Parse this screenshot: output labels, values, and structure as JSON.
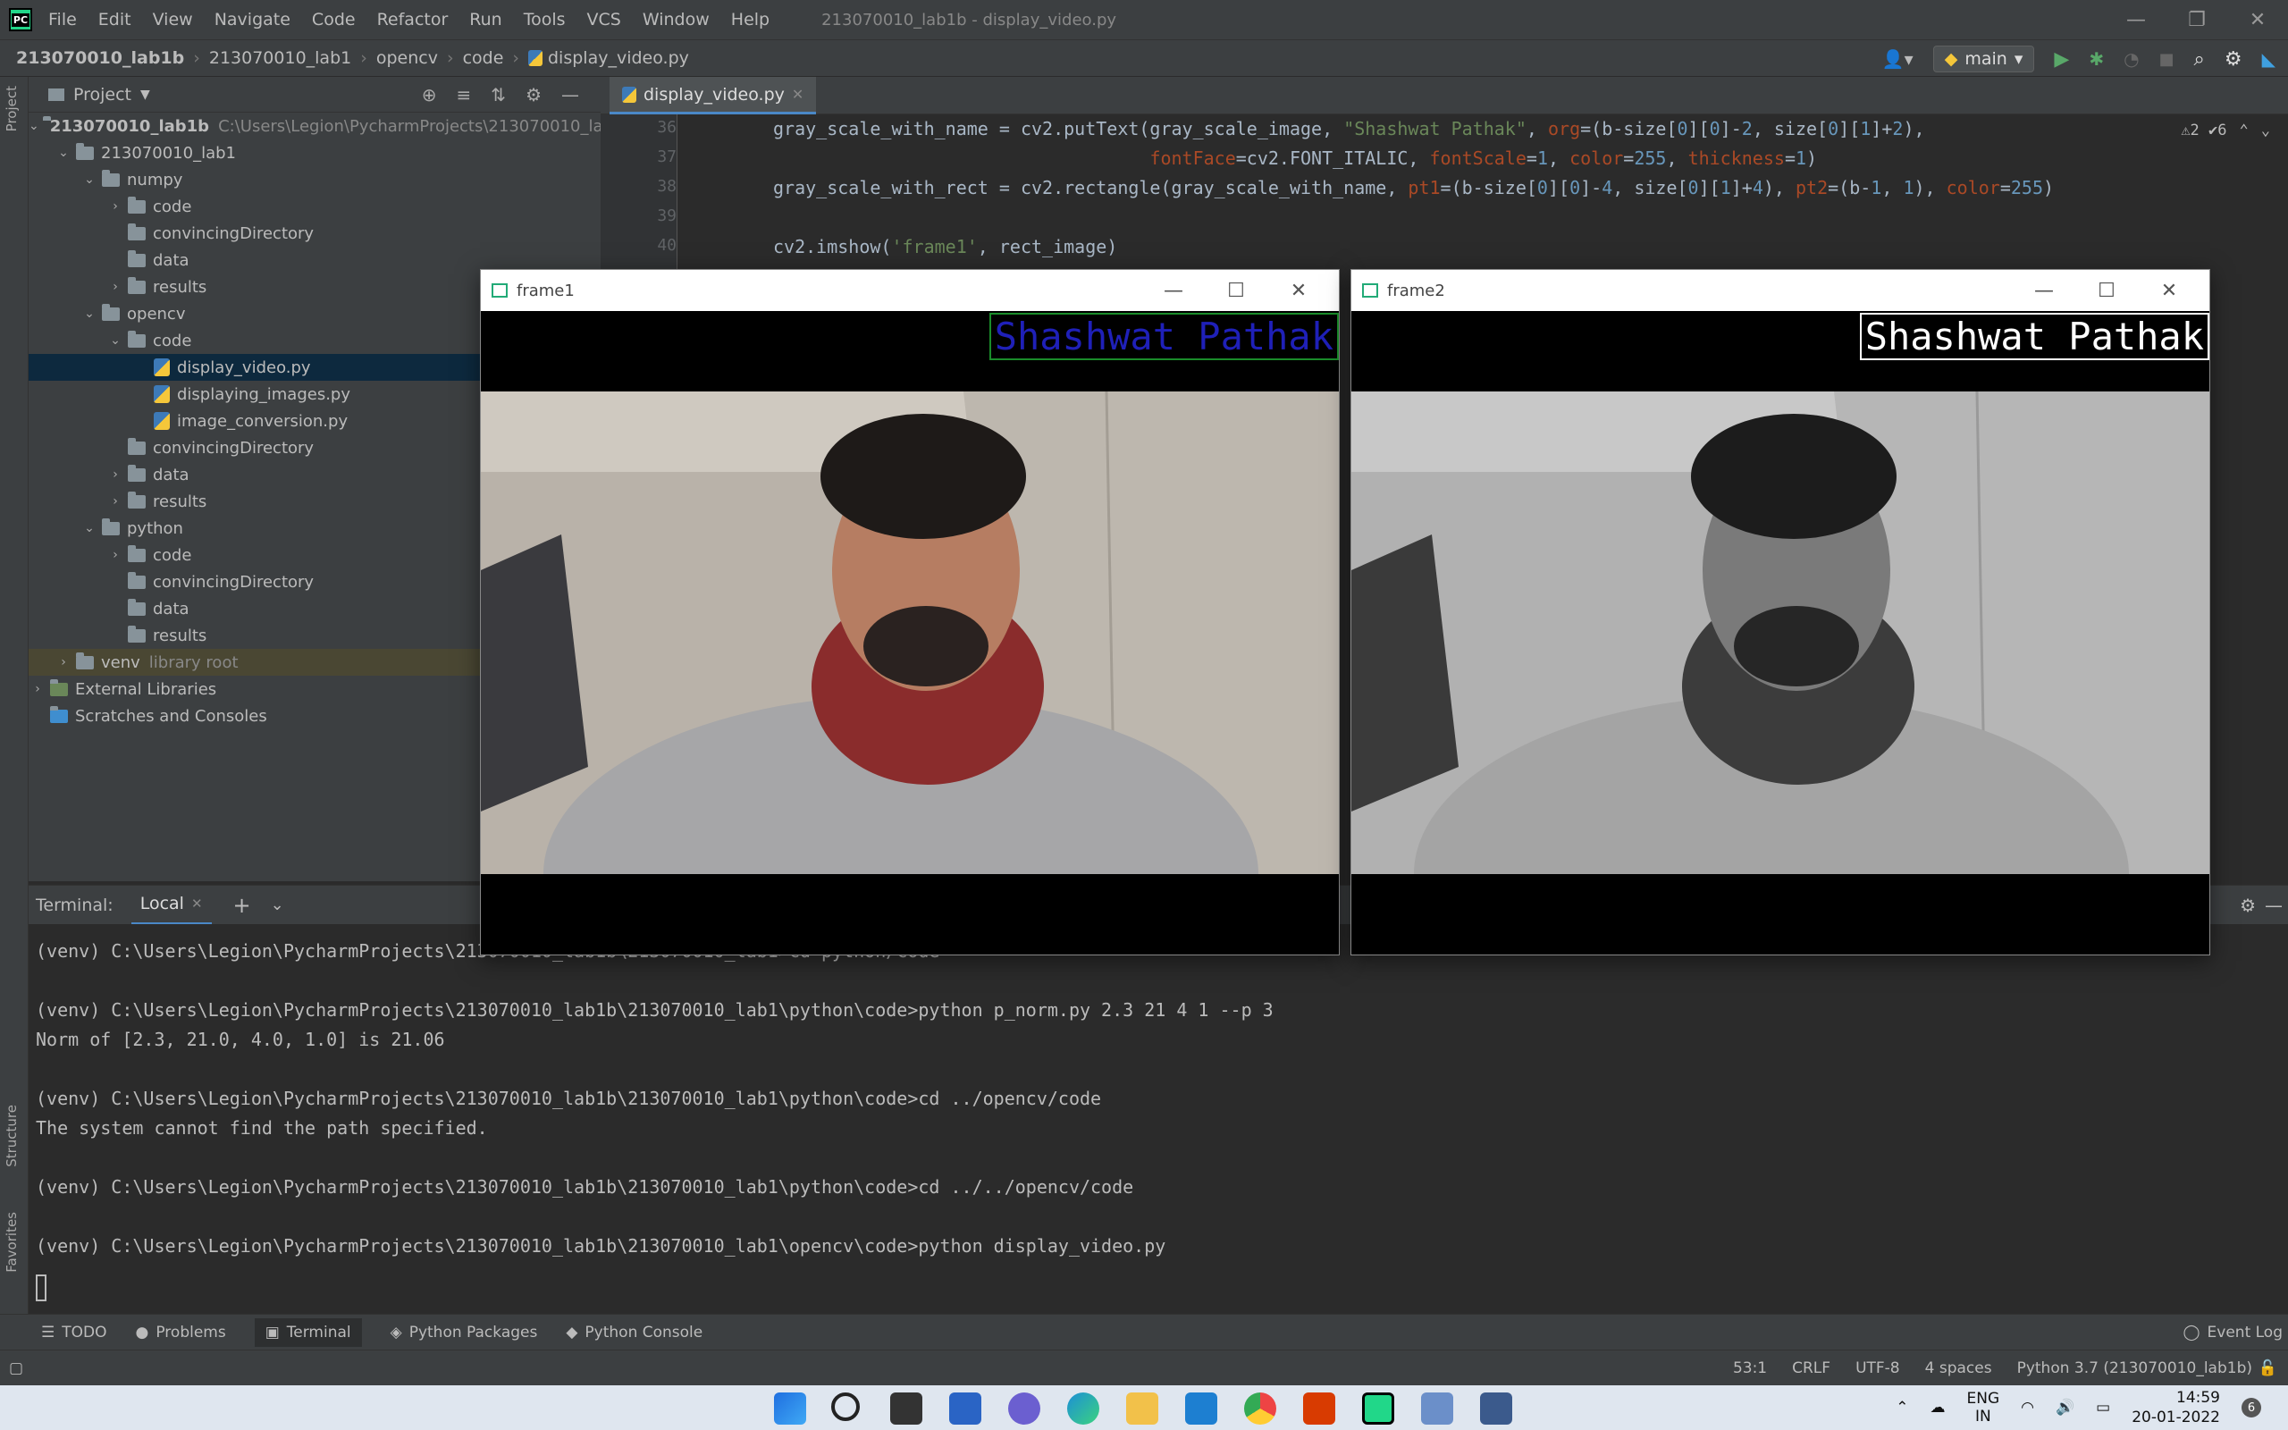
{
  "menubar": {
    "logo_text": "PC",
    "items": [
      "File",
      "Edit",
      "View",
      "Navigate",
      "Code",
      "Refactor",
      "Run",
      "Tools",
      "VCS",
      "Window",
      "Help"
    ],
    "window_title": "213070010_lab1b - display_video.py"
  },
  "navbar": {
    "crumbs": [
      "213070010_lab1b",
      "213070010_lab1",
      "opencv",
      "code",
      "display_video.py"
    ],
    "branch": "main"
  },
  "left_strip": {
    "project": "Project",
    "structure": "Structure",
    "favorites": "Favorites"
  },
  "project": {
    "header": "Project",
    "tree": [
      {
        "label": "213070010_lab1b",
        "path": "C:\\Users\\Legion\\PycharmProjects\\213070010_lab1b",
        "depth": 0,
        "type": "folder",
        "expanded": true,
        "bold": true
      },
      {
        "label": "213070010_lab1",
        "depth": 1,
        "type": "folder",
        "expanded": true
      },
      {
        "label": "numpy",
        "depth": 2,
        "type": "folder",
        "expanded": true
      },
      {
        "label": "code",
        "depth": 3,
        "type": "folder",
        "expanded": false
      },
      {
        "label": "convincingDirectory",
        "depth": 3,
        "type": "folder"
      },
      {
        "label": "data",
        "depth": 3,
        "type": "folder"
      },
      {
        "label": "results",
        "depth": 3,
        "type": "folder",
        "expanded": false
      },
      {
        "label": "opencv",
        "depth": 2,
        "type": "folder",
        "expanded": true
      },
      {
        "label": "code",
        "depth": 3,
        "type": "folder",
        "expanded": true
      },
      {
        "label": "display_video.py",
        "depth": 4,
        "type": "py",
        "selected": true
      },
      {
        "label": "displaying_images.py",
        "depth": 4,
        "type": "py"
      },
      {
        "label": "image_conversion.py",
        "depth": 4,
        "type": "py"
      },
      {
        "label": "convincingDirectory",
        "depth": 3,
        "type": "folder"
      },
      {
        "label": "data",
        "depth": 3,
        "type": "folder",
        "expanded": false
      },
      {
        "label": "results",
        "depth": 3,
        "type": "folder",
        "expanded": false
      },
      {
        "label": "python",
        "depth": 2,
        "type": "folder",
        "expanded": true
      },
      {
        "label": "code",
        "depth": 3,
        "type": "folder",
        "expanded": false
      },
      {
        "label": "convincingDirectory",
        "depth": 3,
        "type": "folder"
      },
      {
        "label": "data",
        "depth": 3,
        "type": "folder"
      },
      {
        "label": "results",
        "depth": 3,
        "type": "folder"
      },
      {
        "label": "venv",
        "path": "library root",
        "depth": 1,
        "type": "folder",
        "expanded": false,
        "venv": true
      },
      {
        "label": "External Libraries",
        "depth": 0,
        "type": "lib",
        "expanded": false
      },
      {
        "label": "Scratches and Consoles",
        "depth": 0,
        "type": "scratch"
      }
    ]
  },
  "editor": {
    "tab": "display_video.py",
    "warnings": "⚠2  ✔6",
    "lines": [
      {
        "n": "36",
        "parts": [
          [
            "gray_scale_with_name = cv2.putText(gray_scale_image, ",
            ""
          ],
          [
            "\"Shashwat Pathak\"",
            "str"
          ],
          [
            ", ",
            ""
          ],
          [
            "org",
            "param"
          ],
          [
            "=(b-size[",
            ""
          ],
          [
            "0",
            "num"
          ],
          [
            "][",
            ""
          ],
          [
            "0",
            "num"
          ],
          [
            "]-",
            ""
          ],
          [
            "2",
            "num"
          ],
          [
            ", size[",
            ""
          ],
          [
            "0",
            "num"
          ],
          [
            "][",
            ""
          ],
          [
            "1",
            "num"
          ],
          [
            "]+",
            ""
          ],
          [
            "2",
            "num"
          ],
          [
            "),",
            ""
          ]
        ]
      },
      {
        "n": "37",
        "parts": [
          [
            "                                   ",
            ""
          ],
          [
            "fontFace",
            "param"
          ],
          [
            "=cv2.FONT_ITALIC, ",
            ""
          ],
          [
            "fontScale",
            "param"
          ],
          [
            "=",
            ""
          ],
          [
            "1",
            "num"
          ],
          [
            ", ",
            ""
          ],
          [
            "color",
            "param"
          ],
          [
            "=",
            ""
          ],
          [
            "255",
            "num"
          ],
          [
            ", ",
            ""
          ],
          [
            "thickness",
            "param"
          ],
          [
            "=",
            ""
          ],
          [
            "1",
            "num"
          ],
          [
            ")",
            ""
          ]
        ]
      },
      {
        "n": "38",
        "parts": [
          [
            "gray_scale_with_rect = cv2.rectangle(gray_scale_with_name, ",
            ""
          ],
          [
            "pt1",
            "param"
          ],
          [
            "=(b-size[",
            ""
          ],
          [
            "0",
            "num"
          ],
          [
            "][",
            ""
          ],
          [
            "0",
            "num"
          ],
          [
            "]-",
            ""
          ],
          [
            "4",
            "num"
          ],
          [
            ", size[",
            ""
          ],
          [
            "0",
            "num"
          ],
          [
            "][",
            ""
          ],
          [
            "1",
            "num"
          ],
          [
            "]+",
            ""
          ],
          [
            "4",
            "num"
          ],
          [
            "), ",
            ""
          ],
          [
            "pt2",
            "param"
          ],
          [
            "=(b-",
            ""
          ],
          [
            "1",
            "num"
          ],
          [
            ", ",
            ""
          ],
          [
            "1",
            "num"
          ],
          [
            "), ",
            ""
          ],
          [
            "color",
            "param"
          ],
          [
            "=",
            ""
          ],
          [
            "255",
            "num"
          ],
          [
            ")",
            ""
          ]
        ]
      },
      {
        "n": "39",
        "parts": []
      },
      {
        "n": "40",
        "parts": [
          [
            "cv2.imshow(",
            ""
          ],
          [
            "'frame1'",
            "str"
          ],
          [
            ", rect_image)",
            ""
          ]
        ]
      }
    ]
  },
  "frames": [
    {
      "title": "frame1",
      "overlay_text": "Shashwat Pathak",
      "text_color": "#1f20b8",
      "rect_color": "#1a8c2a",
      "grayscale": false
    },
    {
      "title": "frame2",
      "overlay_text": "Shashwat Pathak",
      "text_color": "#ffffff",
      "rect_color": "#ffffff",
      "grayscale": true
    }
  ],
  "terminal": {
    "label": "Terminal:",
    "tab": "Local",
    "lines": [
      "(venv) C:\\Users\\Legion\\PycharmProjects\\213070010_lab1b\\213070010_lab1>cd python/code",
      "",
      "(venv) C:\\Users\\Legion\\PycharmProjects\\213070010_lab1b\\213070010_lab1\\python\\code>python p_norm.py 2.3 21 4 1 --p 3",
      "Norm of [2.3, 21.0, 4.0, 1.0] is 21.06",
      "",
      "(venv) C:\\Users\\Legion\\PycharmProjects\\213070010_lab1b\\213070010_lab1\\python\\code>cd ../opencv/code",
      "The system cannot find the path specified.",
      "",
      "(venv) C:\\Users\\Legion\\PycharmProjects\\213070010_lab1b\\213070010_lab1\\python\\code>cd ../../opencv/code",
      "",
      "(venv) C:\\Users\\Legion\\PycharmProjects\\213070010_lab1b\\213070010_lab1\\opencv\\code>python display_video.py"
    ]
  },
  "bottom_tabs": [
    "TODO",
    "Problems",
    "Terminal",
    "Python Packages",
    "Python Console"
  ],
  "event_log": "Event Log",
  "status": {
    "position": "53:1",
    "line_sep": "CRLF",
    "encoding": "UTF-8",
    "indent": "4 spaces",
    "interpreter": "Python 3.7 (213070010_lab1b)"
  },
  "tray": {
    "lang": "ENG",
    "region": "IN",
    "time": "14:59",
    "date": "20-01-2022",
    "notif_count": "6"
  },
  "colors": {
    "accent": "#4a88c7",
    "selection": "#0d293e"
  }
}
